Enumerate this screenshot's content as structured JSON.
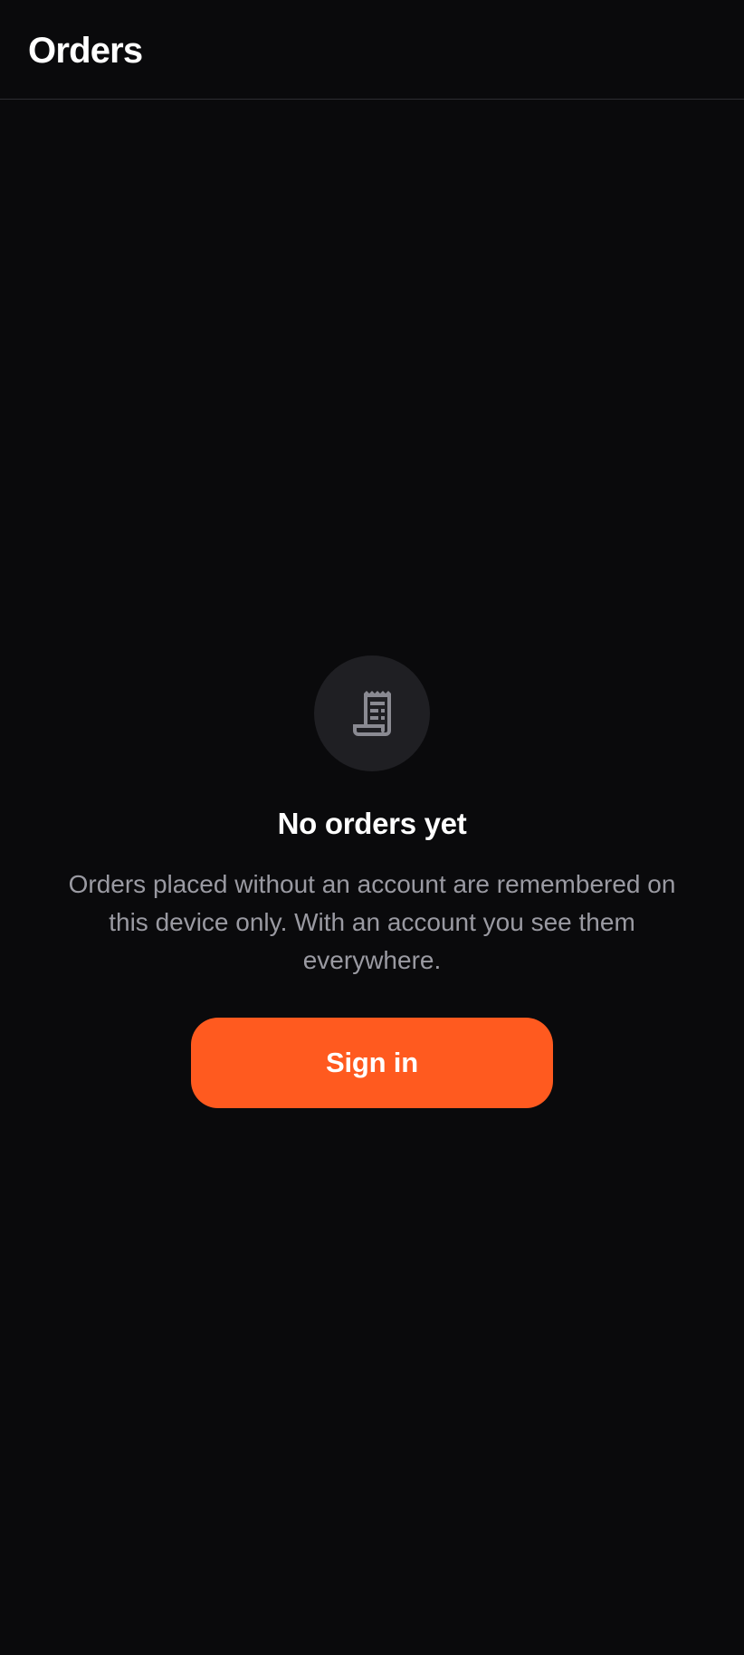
{
  "header": {
    "title": "Orders"
  },
  "empty_state": {
    "icon": "receipt-icon",
    "title": "No orders yet",
    "message": "Orders placed without an account are remembered on this device only. With an account you see them everywhere.",
    "button_label": "Sign in"
  },
  "colors": {
    "background": "#0a0a0c",
    "accent": "#ff5a1f",
    "muted_text": "#9a9aa2",
    "icon_circle": "#1f1f23",
    "divider": "#2e2e33"
  }
}
